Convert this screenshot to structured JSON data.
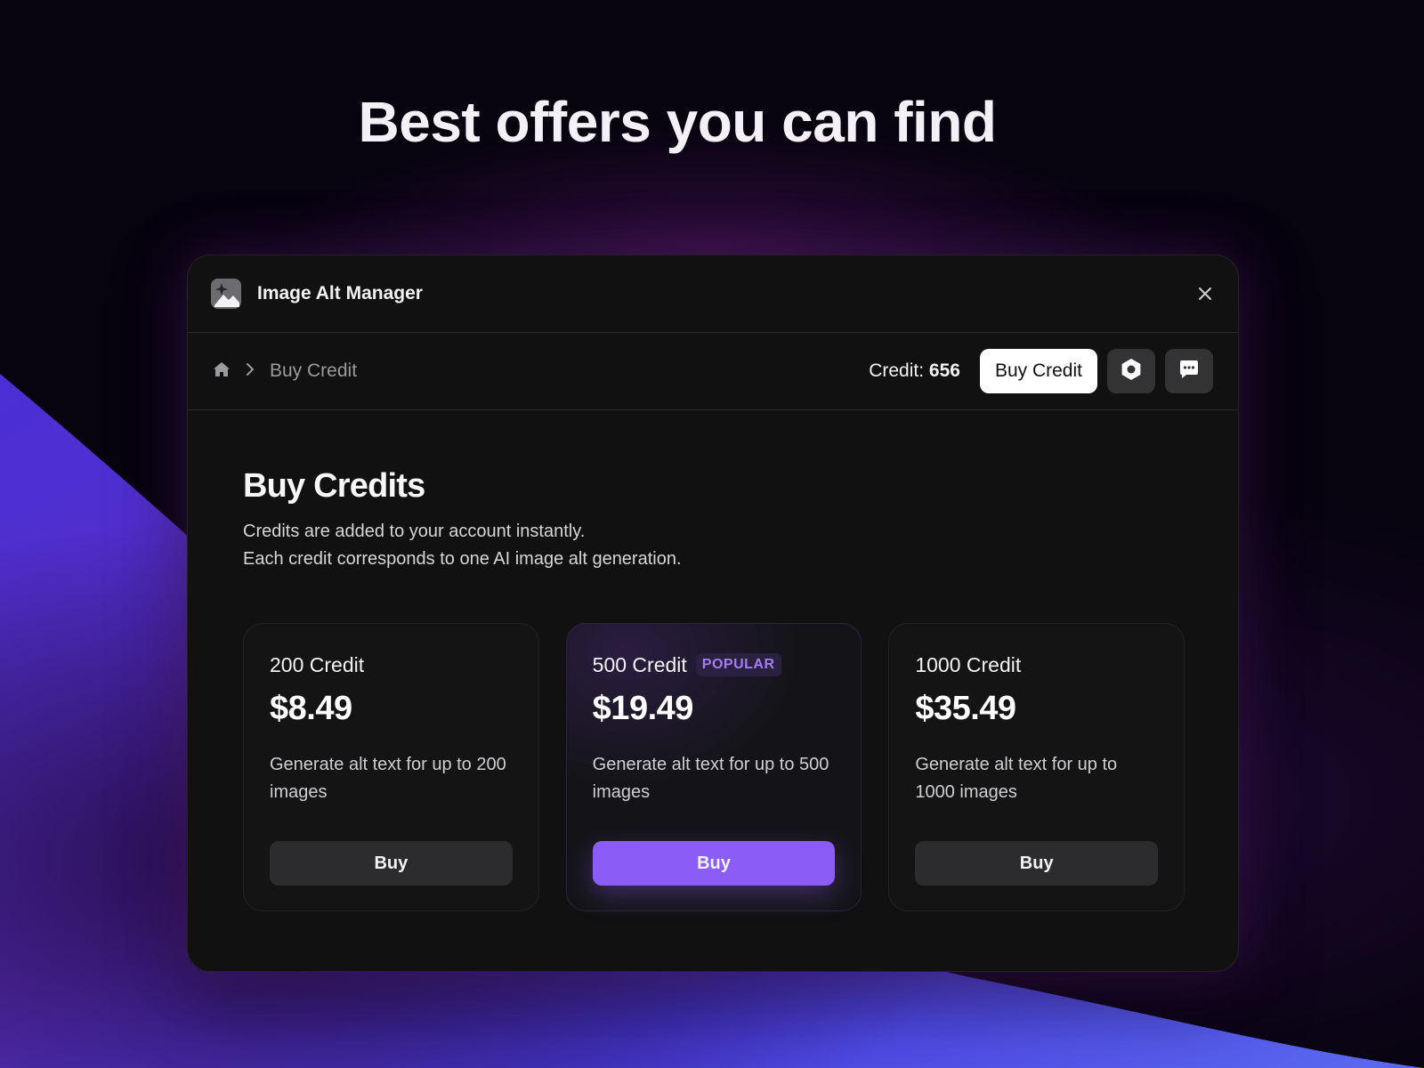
{
  "headline": "Best offers you can find",
  "window": {
    "title": "Image Alt Manager",
    "icons": {
      "app": "image-sparkle-icon",
      "close": "close-icon"
    }
  },
  "navbar": {
    "breadcrumb": {
      "home_icon": "home-icon",
      "separator_icon": "chevron-right-icon",
      "current": "Buy Credit"
    },
    "credit_label": "Credit:",
    "credit_value": "656",
    "buy_credit_label": "Buy Credit",
    "settings_icon": "settings-hexagon-icon",
    "chat_icon": "chat-icon"
  },
  "page": {
    "title": "Buy Credits",
    "description_line1": "Credits are added to your account instantly.",
    "description_line2": "Each credit corresponds to one AI image alt generation."
  },
  "plans": [
    {
      "name": "200 Credit",
      "price": "$8.49",
      "description": "Generate alt text for up to 200 images",
      "button": "Buy",
      "badge": ""
    },
    {
      "name": "500 Credit",
      "price": "$19.49",
      "description": "Generate alt text for up to 500 images",
      "button": "Buy",
      "badge": "POPULAR"
    },
    {
      "name": "1000 Credit",
      "price": "$35.49",
      "description": "Generate alt text for up to 1000 images",
      "button": "Buy",
      "badge": ""
    }
  ],
  "colors": {
    "accent": "#8b5cf6",
    "badge_text": "#a47cf4",
    "window_bg": "#111112",
    "page_bg": "#07030f"
  }
}
